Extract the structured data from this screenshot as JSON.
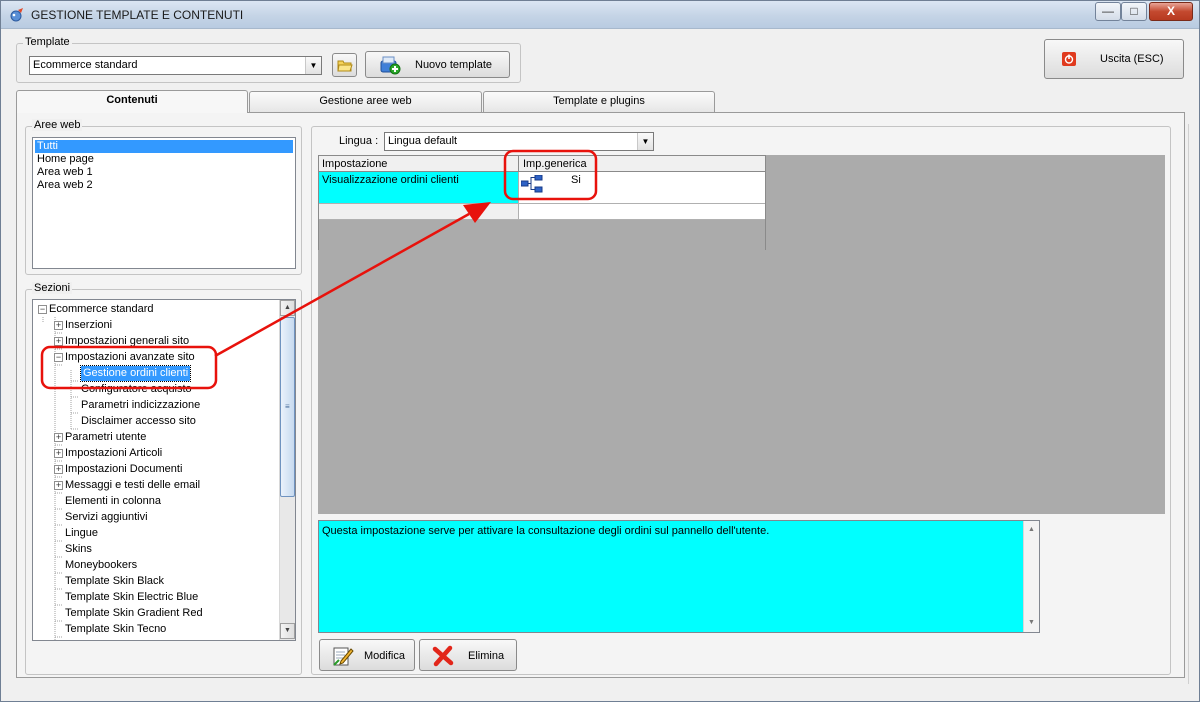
{
  "window": {
    "title": "GESTIONE TEMPLATE E CONTENUTI",
    "minimize": "—",
    "maximize": "□",
    "close": "X"
  },
  "template_group": {
    "label": "Template",
    "selected": "Ecommerce standard",
    "new_button": "Nuovo template"
  },
  "exit_button": "Uscita (ESC)",
  "tabs": [
    {
      "label": "Contenuti",
      "active": true
    },
    {
      "label": "Gestione aree web",
      "active": false
    },
    {
      "label": "Template e plugins",
      "active": false
    }
  ],
  "aree_web": {
    "label": "Aree web",
    "items": [
      "Tutti",
      "Home page",
      "Area web 1",
      "Area web 2"
    ],
    "selected_index": 0
  },
  "sezioni": {
    "label": "Sezioni",
    "items": [
      {
        "label": "Ecommerce standard",
        "level": 0,
        "expander": "−"
      },
      {
        "label": "Inserzioni",
        "level": 1,
        "expander": "+"
      },
      {
        "label": "Impostazioni generali sito",
        "level": 1,
        "expander": "+"
      },
      {
        "label": "Impostazioni avanzate sito",
        "level": 1,
        "expander": "−"
      },
      {
        "label": "Gestione ordini clienti",
        "level": 2,
        "selected": true
      },
      {
        "label": "Configuratore acquisto",
        "level": 2
      },
      {
        "label": "Parametri indicizzazione",
        "level": 2
      },
      {
        "label": "Disclaimer accesso sito",
        "level": 2
      },
      {
        "label": "Parametri utente",
        "level": 1,
        "expander": "+"
      },
      {
        "label": "Impostazioni Articoli",
        "level": 1,
        "expander": "+"
      },
      {
        "label": "Impostazioni Documenti",
        "level": 1,
        "expander": "+"
      },
      {
        "label": "Messaggi e testi delle email",
        "level": 1,
        "expander": "+"
      },
      {
        "label": "Elementi in colonna",
        "level": 1
      },
      {
        "label": "Servizi aggiuntivi",
        "level": 1
      },
      {
        "label": "Lingue",
        "level": 1
      },
      {
        "label": "Skins",
        "level": 1
      },
      {
        "label": "Moneybookers",
        "level": 1
      },
      {
        "label": "Template Skin Black",
        "level": 1
      },
      {
        "label": "Template Skin Electric Blue",
        "level": 1
      },
      {
        "label": "Template Skin Gradient Red",
        "level": 1
      },
      {
        "label": "Template Skin Tecno",
        "level": 1
      }
    ]
  },
  "lingua": {
    "label": "Lingua :",
    "selected": "Lingua default"
  },
  "grid": {
    "columns": [
      "Impostazione",
      "Imp.generica"
    ],
    "rows": [
      {
        "impostazione": "Visualizzazione ordini clienti",
        "value": "Si"
      }
    ]
  },
  "description": "Questa impostazione serve per attivare la consultazione degli ordini sul pannello dell'utente.",
  "buttons": {
    "modifica": "Modifica",
    "elimina": "Elimina"
  },
  "colors": {
    "selection": "#3399ff",
    "highlight_cell": "#00ffff",
    "annotation_red": "#e8120c",
    "grid_background": "#ababab"
  }
}
